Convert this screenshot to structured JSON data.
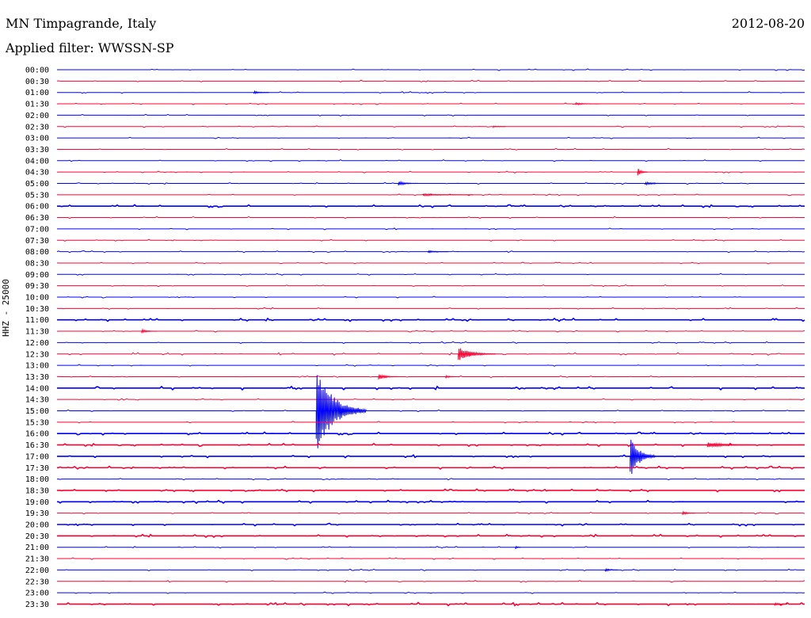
{
  "header": {
    "station": "MN Timpagrande, Italy",
    "date": "2012-08-20",
    "filter": "Applied filter: WWSSN-SP"
  },
  "colors": {
    "even_row": "#0000ff",
    "odd_row": "#ff0033"
  },
  "chart_data": {
    "type": "line",
    "title": "",
    "ylabel": "HHZ - 25000",
    "row_labels": [
      "00:00",
      "00:30",
      "01:00",
      "01:30",
      "02:00",
      "02:30",
      "03:00",
      "03:30",
      "04:00",
      "04:30",
      "05:00",
      "05:30",
      "06:00",
      "06:30",
      "07:00",
      "07:30",
      "08:00",
      "08:30",
      "09:00",
      "09:30",
      "10:00",
      "10:30",
      "11:00",
      "11:30",
      "12:00",
      "12:30",
      "13:00",
      "13:30",
      "14:00",
      "14:30",
      "15:00",
      "15:30",
      "16:00",
      "16:30",
      "17:00",
      "17:30",
      "18:00",
      "18:30",
      "19:00",
      "19:30",
      "20:00",
      "20:30",
      "21:00",
      "21:30",
      "22:00",
      "22:30",
      "23:00",
      "23:30"
    ],
    "row_minutes": 30,
    "trace_noise": [
      1,
      1,
      1,
      1,
      1,
      1,
      1,
      1,
      1,
      1,
      1,
      1,
      1.6,
      1,
      1,
      1,
      1,
      1,
      1,
      1,
      1,
      1,
      1.8,
      1,
      1,
      1.4,
      1,
      1,
      2,
      1,
      1,
      1,
      1.6,
      1.6,
      1.6,
      1.6,
      1,
      1.6,
      1.6,
      1,
      1.6,
      1.6,
      1,
      1,
      1,
      1,
      1,
      1.8
    ],
    "events": [
      {
        "row": 2,
        "minute": 7.9,
        "amp": 2,
        "dur": 0.6
      },
      {
        "row": 3,
        "minute": 20.8,
        "amp": 1.5,
        "dur": 1.0
      },
      {
        "row": 5,
        "minute": 17.5,
        "amp": 1,
        "dur": 0.5
      },
      {
        "row": 9,
        "minute": 23.3,
        "amp": 6,
        "dur": 0.4
      },
      {
        "row": 10,
        "minute": 13.7,
        "amp": 3,
        "dur": 0.8
      },
      {
        "row": 10,
        "minute": 23.6,
        "amp": 2,
        "dur": 1.0
      },
      {
        "row": 11,
        "minute": 14.7,
        "amp": 1.5,
        "dur": 2.0
      },
      {
        "row": 16,
        "minute": 14.9,
        "amp": 1.5,
        "dur": 0.8
      },
      {
        "row": 23,
        "minute": 3.4,
        "amp": 2.5,
        "dur": 0.6
      },
      {
        "row": 25,
        "minute": 16.1,
        "amp": 9,
        "dur": 1.5
      },
      {
        "row": 27,
        "minute": 12.9,
        "amp": 4,
        "dur": 0.8
      },
      {
        "row": 27,
        "minute": 15.6,
        "amp": 2,
        "dur": 0.4
      },
      {
        "row": 30,
        "minute": 10.4,
        "amp": 55,
        "dur": 2.0
      },
      {
        "row": 30,
        "minute": 11.3,
        "amp": 6,
        "dur": 0.8
      },
      {
        "row": 33,
        "minute": 26.1,
        "amp": 4,
        "dur": 1.8
      },
      {
        "row": 34,
        "minute": 23.0,
        "amp": 28,
        "dur": 1.0
      },
      {
        "row": 39,
        "minute": 25.1,
        "amp": 2.5,
        "dur": 0.5
      },
      {
        "row": 42,
        "minute": 18.4,
        "amp": 2.5,
        "dur": 0.2
      },
      {
        "row": 44,
        "minute": 22.0,
        "amp": 2,
        "dur": 0.5
      },
      {
        "row": 47,
        "minute": 28.8,
        "amp": 2,
        "dur": 0.5
      }
    ]
  }
}
